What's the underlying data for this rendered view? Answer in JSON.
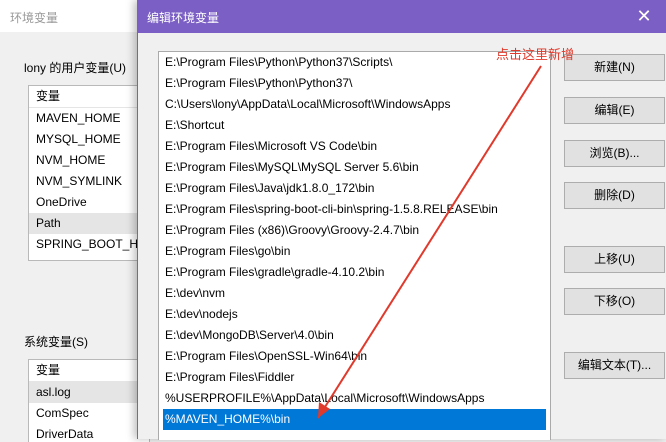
{
  "background_window": {
    "title": "环境变量",
    "user_vars_label": "lony 的用户变量(U)",
    "user_vars": {
      "header": "变量",
      "rows": [
        "MAVEN_HOME",
        "MYSQL_HOME",
        "NVM_HOME",
        "NVM_SYMLINK",
        "OneDrive",
        "Path",
        "SPRING_BOOT_HO"
      ],
      "selected": "Path"
    },
    "system_vars_label": "系统变量(S)",
    "system_vars": {
      "header": "变量",
      "rows": [
        "asl.log",
        "ComSpec",
        "DriverData"
      ]
    }
  },
  "dialog": {
    "title": "编辑环境变量",
    "close_icon": "close-icon",
    "paths": [
      "E:\\Program Files\\Python\\Python37\\Scripts\\",
      "E:\\Program Files\\Python\\Python37\\",
      "C:\\Users\\lony\\AppData\\Local\\Microsoft\\WindowsApps",
      "E:\\Shortcut",
      "E:\\Program Files\\Microsoft VS Code\\bin",
      "E:\\Program Files\\MySQL\\MySQL Server 5.6\\bin",
      "E:\\Program Files\\Java\\jdk1.8.0_172\\bin",
      "E:\\Program Files\\spring-boot-cli-bin\\spring-1.5.8.RELEASE\\bin",
      "E:\\Program Files (x86)\\Groovy\\Groovy-2.4.7\\bin",
      "E:\\Program Files\\go\\bin",
      "E:\\Program Files\\gradle\\gradle-4.10.2\\bin",
      "E:\\dev\\nvm",
      "E:\\dev\\nodejs",
      "E:\\dev\\MongoDB\\Server\\4.0\\bin",
      "E:\\Program Files\\OpenSSL-Win64\\bin",
      "E:\\Program Files\\Fiddler",
      "%USERPROFILE%\\AppData\\Local\\Microsoft\\WindowsApps",
      "%MAVEN_HOME%\\bin"
    ],
    "selected_path": "%MAVEN_HOME%\\bin",
    "buttons": {
      "new": "新建(N)",
      "edit": "编辑(E)",
      "browse": "浏览(B)...",
      "delete": "删除(D)",
      "move_up": "上移(U)",
      "move_down": "下移(O)",
      "edit_text": "编辑文本(T)..."
    }
  },
  "annotation": {
    "text": "点击这里新增",
    "color": "#e03a2c"
  },
  "colors": {
    "titlebar": "#7b5fc5",
    "selection": "#0078d7"
  }
}
